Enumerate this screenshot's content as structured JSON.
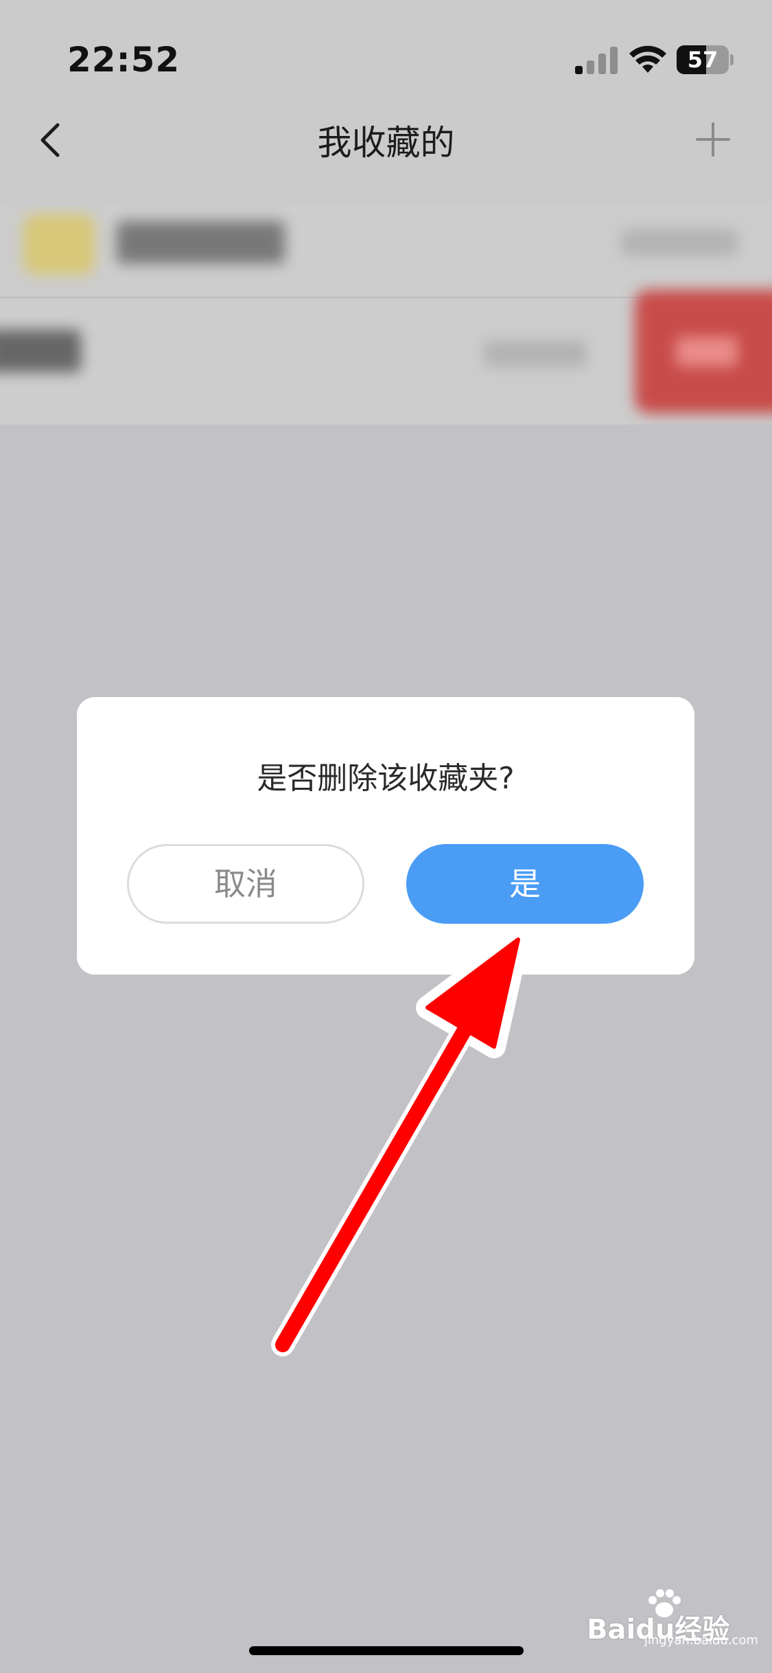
{
  "status_bar": {
    "time": "22:52",
    "battery": "57"
  },
  "nav": {
    "title": "我收藏的"
  },
  "dialog": {
    "message": "是否删除该收藏夹?",
    "cancel_label": "取消",
    "confirm_label": "是"
  },
  "watermark": {
    "brand": "Baidu经验",
    "url": "jingyan.baidu.com"
  },
  "colors": {
    "confirm": "#4a9cf5",
    "arrow": "#ff0000",
    "delete": "#c84c4a"
  }
}
